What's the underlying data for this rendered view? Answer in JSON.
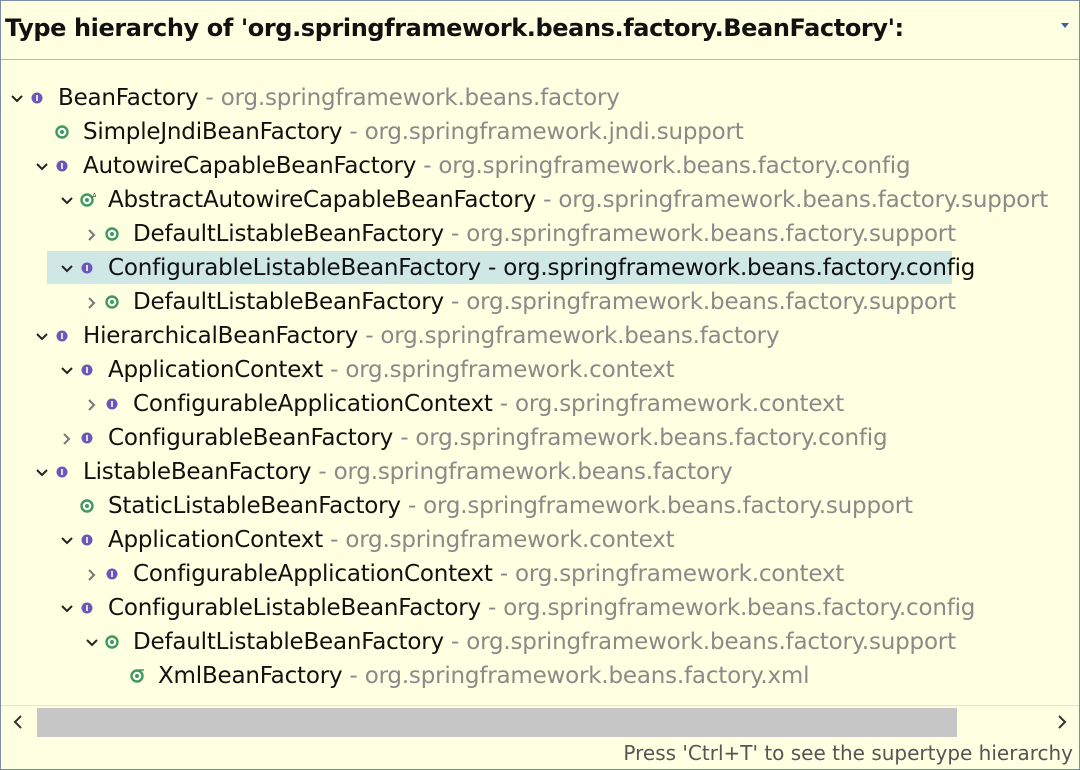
{
  "header": {
    "title": "Type hierarchy of 'org.springframework.beans.factory.BeanFactory':"
  },
  "tree": [
    {
      "name": "BeanFactory",
      "pkg": "- org.springframework.beans.factory",
      "expanded": true,
      "icon": "interface-icon",
      "twisty": "down"
    },
    {
      "name": "SimpleJndiBeanFactory",
      "pkg": "- org.springframework.jndi.support",
      "icon": "class-icon",
      "twisty": "none"
    },
    {
      "name": "AutowireCapableBeanFactory",
      "pkg": "- org.springframework.beans.factory.config",
      "icon": "interface-icon",
      "twisty": "down"
    },
    {
      "name": "AbstractAutowireCapableBeanFactory",
      "pkg": "- org.springframework.beans.factory.support",
      "icon": "abstract-class-icon",
      "twisty": "down"
    },
    {
      "name": "DefaultListableBeanFactory",
      "pkg": "- org.springframework.beans.factory.support",
      "icon": "class-icon",
      "twisty": "right"
    },
    {
      "name": "ConfigurableListableBeanFactory",
      "pkg": "- org.springframework.beans.factory.config",
      "icon": "interface-icon",
      "twisty": "down",
      "selected": true
    },
    {
      "name": "DefaultListableBeanFactory",
      "pkg": "- org.springframework.beans.factory.support",
      "icon": "class-icon",
      "twisty": "right"
    },
    {
      "name": "HierarchicalBeanFactory",
      "pkg": "- org.springframework.beans.factory",
      "icon": "interface-icon",
      "twisty": "down"
    },
    {
      "name": "ApplicationContext",
      "pkg": "- org.springframework.context",
      "icon": "interface-icon",
      "twisty": "down"
    },
    {
      "name": "ConfigurableApplicationContext",
      "pkg": "- org.springframework.context",
      "icon": "interface-icon",
      "twisty": "right"
    },
    {
      "name": "ConfigurableBeanFactory",
      "pkg": "- org.springframework.beans.factory.config",
      "icon": "interface-icon",
      "twisty": "right"
    },
    {
      "name": "ListableBeanFactory",
      "pkg": "- org.springframework.beans.factory",
      "icon": "interface-icon",
      "twisty": "down"
    },
    {
      "name": "StaticListableBeanFactory",
      "pkg": "- org.springframework.beans.factory.support",
      "icon": "class-icon",
      "twisty": "none"
    },
    {
      "name": "ApplicationContext",
      "pkg": "- org.springframework.context",
      "icon": "interface-icon",
      "twisty": "down"
    },
    {
      "name": "ConfigurableApplicationContext",
      "pkg": "- org.springframework.context",
      "icon": "interface-icon",
      "twisty": "right"
    },
    {
      "name": "ConfigurableListableBeanFactory",
      "pkg": "- org.springframework.beans.factory.config",
      "icon": "interface-icon",
      "twisty": "down"
    },
    {
      "name": "DefaultListableBeanFactory",
      "pkg": "- org.springframework.beans.factory.support",
      "icon": "class-icon",
      "twisty": "down"
    },
    {
      "name": "XmlBeanFactory",
      "pkg": "- org.springframework.beans.factory.xml",
      "icon": "deprecated-class-icon",
      "twisty": "none"
    }
  ],
  "status": {
    "hint": "Press 'Ctrl+T' to see the supertype hierarchy"
  },
  "colors": {
    "interface": "#6b57b8",
    "class": "#3f9a5c",
    "selection": "#cfe8e6",
    "package": "#8a8a8a"
  }
}
